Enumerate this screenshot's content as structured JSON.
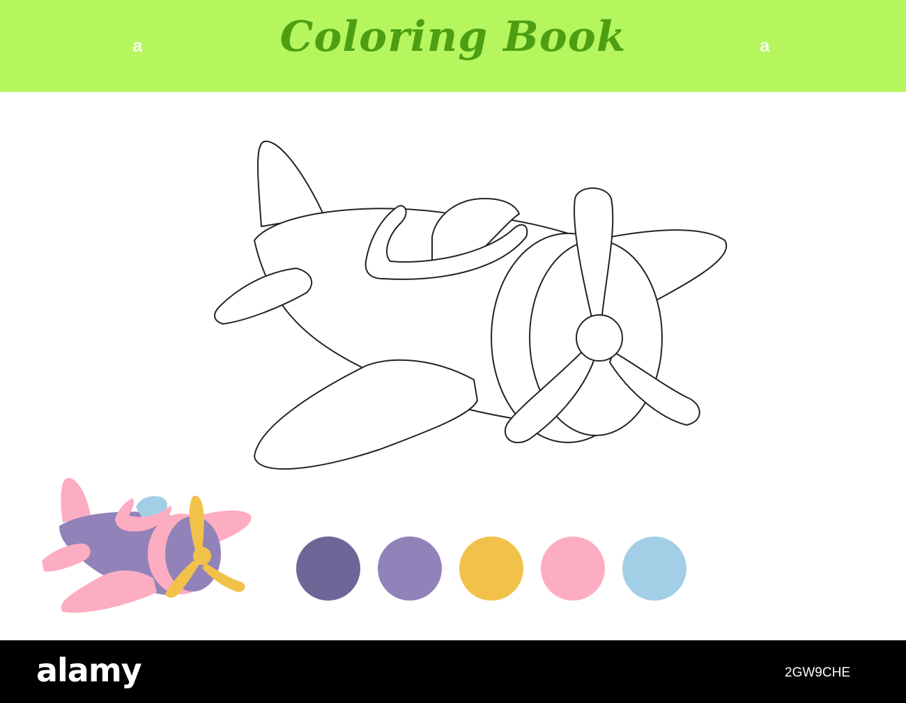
{
  "header": {
    "title": "Coloring Book",
    "background": "#b5f65f",
    "title_color": "#4d9e13",
    "watermark_glyph": "a"
  },
  "worksheet": {
    "outline_icon": "airplane-outline-icon",
    "sample_icon": "airplane-color-icon",
    "palette": [
      {
        "name": "dark-purple",
        "color": "#6c6797"
      },
      {
        "name": "lavender",
        "color": "#9183b9"
      },
      {
        "name": "yellow",
        "color": "#f2c14a"
      },
      {
        "name": "pink",
        "color": "#fdadc2"
      },
      {
        "name": "light-blue",
        "color": "#a2cfe6"
      }
    ]
  },
  "footer": {
    "brand": "alamy",
    "image_id": "2GW9CHE",
    "background": "#000000"
  }
}
